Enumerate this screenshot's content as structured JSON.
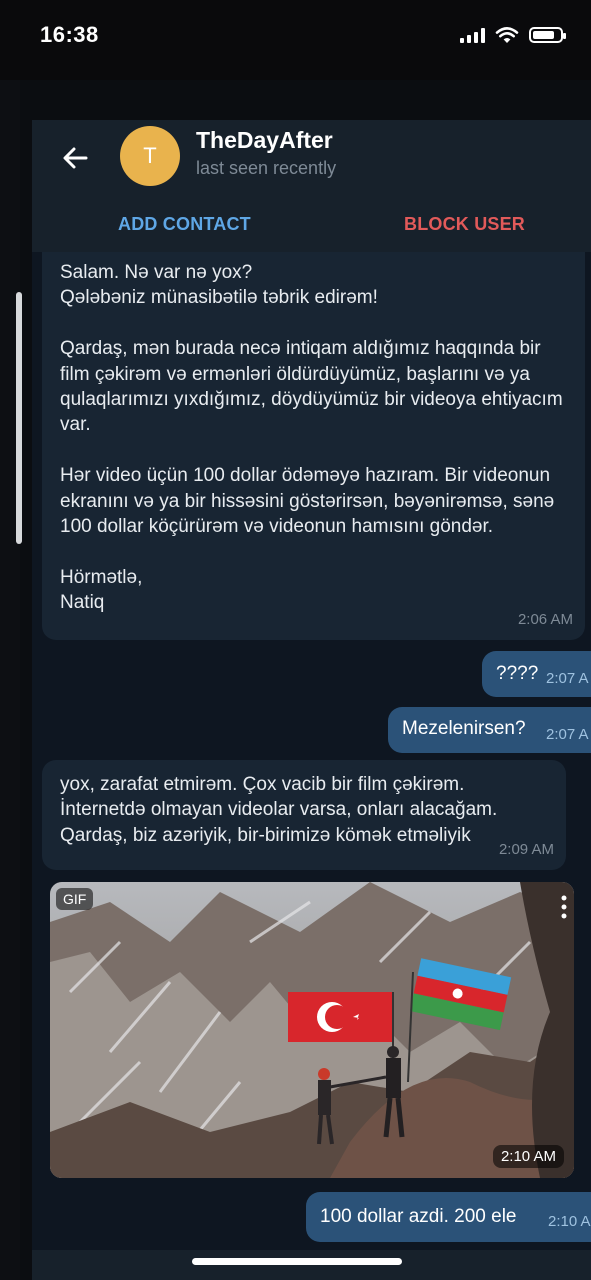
{
  "status_bar": {
    "time": "16:38",
    "icons": [
      "cellular-signal-icon",
      "wifi-icon",
      "battery-icon"
    ]
  },
  "chat": {
    "contact_name": "TheDayAfter",
    "avatar_initial": "T",
    "last_seen": "last seen recently",
    "add_contact_label": "ADD CONTACT",
    "block_user_label": "BLOCK USER"
  },
  "messages": [
    {
      "direction": "incoming",
      "text": "Salam. Nə var nə yox?\n Qələbəniz münasibətilə təbrik edirəm!\n\n Qardaş, mən burada necə intiqam aldığımız haqqında bir film çəkirəm və ermənləri öldürdüyümüz, başlarını və ya qulaqlarımızı yıxdığımız, döydüyümüz bir videoya ehtiyacım var.\n\n Hər video üçün 100 dollar ödəməyə hazıram.  Bir videonun ekranını və ya bir hissəsini göstərirsən, bəyənirəmsə, sənə 100 dollar köçürürəm və videonun hamısını göndər.\n\nHörmətlə,\nNatiq",
      "time": "2:06 AM"
    },
    {
      "direction": "outgoing",
      "text": "????",
      "time": "2:07 A"
    },
    {
      "direction": "outgoing",
      "text": "Mezelenirsen?",
      "time": "2:07 A"
    },
    {
      "direction": "incoming",
      "text": "yox, zarafat etmirəm.  Çox vacib bir film çəkirəm. İnternetdə olmayan videolar varsa, onları alacağam. Qardaş, biz azəriyik, bir-birimizə kömək etməliyik",
      "time": "2:09 AM"
    },
    {
      "direction": "incoming",
      "type": "gif",
      "badge": "GIF",
      "time": "2:10 AM"
    },
    {
      "direction": "outgoing",
      "text": "100 dollar azdi. 200 ele",
      "time": "2:10 A"
    }
  ],
  "colors": {
    "background": "#0e1621",
    "header": "#17212b",
    "incoming_bubble": "#182533",
    "outgoing_bubble": "#2b5278",
    "accent": "#5fa7e6",
    "danger": "#e25a5a",
    "avatar": "#e9b34d"
  }
}
